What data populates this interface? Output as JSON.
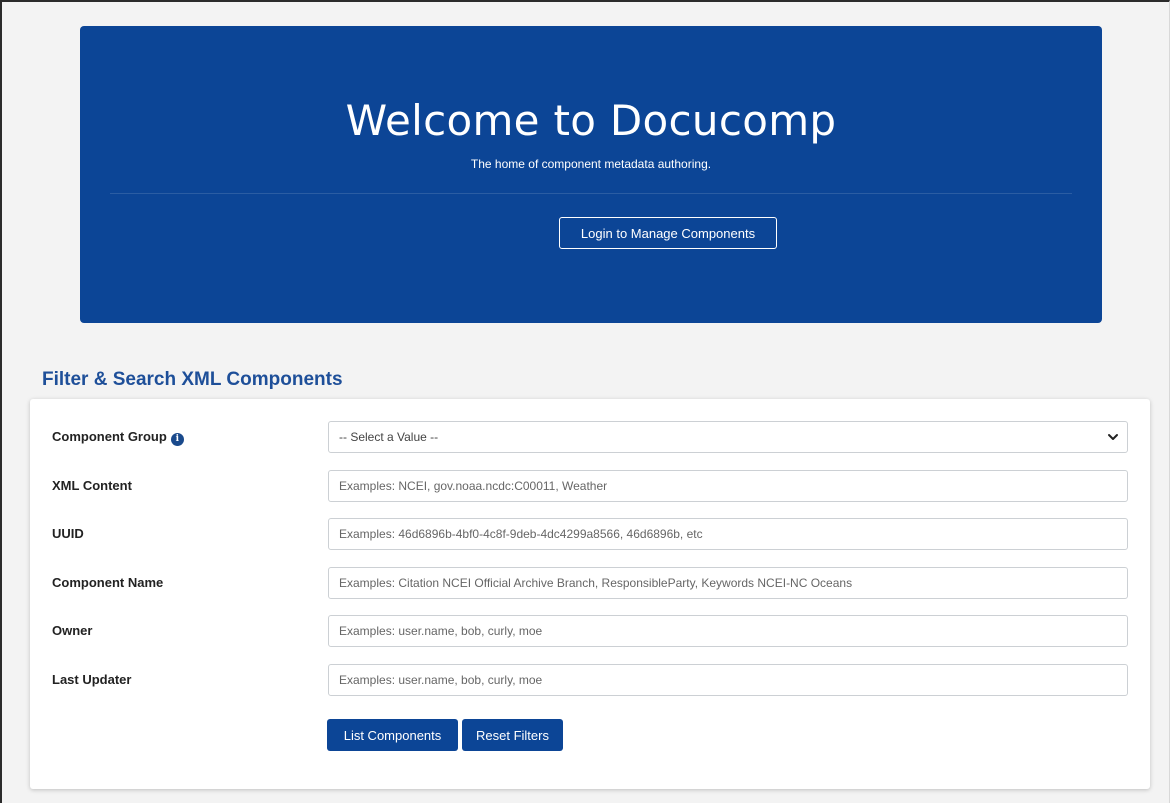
{
  "hero": {
    "title": "Welcome to Docucomp",
    "subtitle": "The home of component metadata authoring.",
    "login_button": "Login to Manage Components"
  },
  "search": {
    "title": "Filter & Search XML Components",
    "fields": [
      {
        "label": "Component Group",
        "value": "-- Select a Value --",
        "info_icon": "info-circle-icon"
      },
      {
        "label": "XML Content",
        "placeholder": "Examples: NCEI, gov.noaa.ncdc:C00011, Weather"
      },
      {
        "label": "UUID",
        "placeholder": "Examples: 46d6896b-4bf0-4c8f-9deb-4dc4299a8566, 46d6896b, etc"
      },
      {
        "label": "Component Name",
        "placeholder": "Examples: Citation NCEI Official Archive Branch, ResponsibleParty, Keywords NCEI-NC Oceans"
      },
      {
        "label": "Owner",
        "placeholder": "Examples: user.name, bob, curly, moe"
      },
      {
        "label": "Last Updater",
        "placeholder": "Examples: user.name, bob, curly, moe"
      }
    ],
    "list_button": "List Components",
    "reset_button": "Reset Filters"
  },
  "colors": {
    "brand_blue": "#0c4596",
    "heading_blue": "#1e4f99"
  }
}
